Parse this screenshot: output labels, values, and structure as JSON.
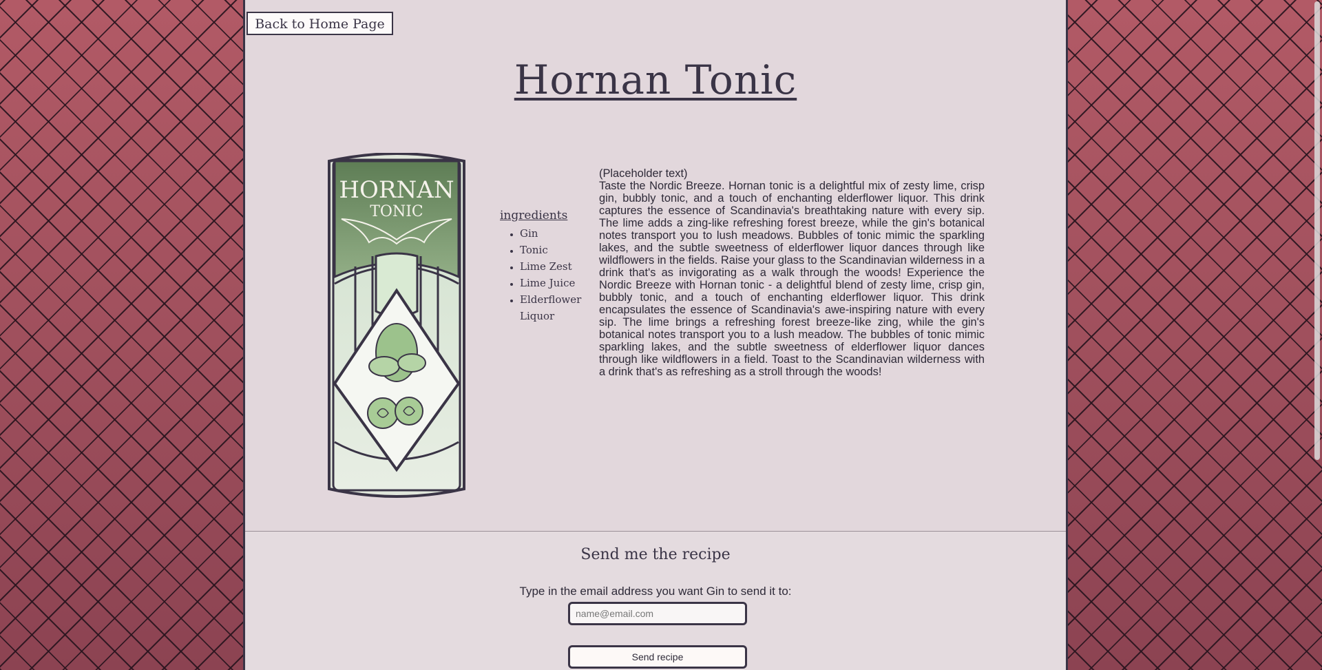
{
  "nav": {
    "back_label": "Back to Home Page"
  },
  "product": {
    "title": "Hornan Tonic",
    "label_brand": "HORNAN",
    "label_sub": "TONIC"
  },
  "ingredients": {
    "heading": "ingredients",
    "items": [
      "Gin",
      "Tonic",
      "Lime Zest",
      "Lime Juice",
      "Elderflower Liquor"
    ]
  },
  "description": {
    "placeholder_note": "(Placeholder text)",
    "body": "Taste the Nordic Breeze. Hornan tonic is a delightful mix of zesty lime, crisp gin, bubbly tonic, and a touch of enchanting elderflower liquor. This drink captures the essence of Scandinavia's breathtaking nature with every sip. The lime adds a zing-like refreshing forest breeze, while the gin's botanical notes transport you to lush meadows. Bubbles of tonic mimic the sparkling lakes, and the subtle sweetness of elderflower liquor dances through like wildflowers in the fields. Raise your glass to the Scandinavian wilderness in a drink that's as invigorating as a walk through the woods! Experience the Nordic Breeze with Hornan tonic - a delightful blend of zesty lime, crisp gin, bubbly tonic, and a touch of enchanting elderflower liquor. This drink encapsulates the essence of Scandinavia's awe-inspiring nature with every sip. The lime brings a refreshing forest breeze-like zing, while the gin's botanical notes transport you to a lush meadow. The bubbles of tonic mimic sparkling lakes, and the subtle sweetness of elderflower liquor dances through like wildflowers in a field. Toast to the Scandinavian wilderness with a drink that's as refreshing as a stroll through the woods!"
  },
  "recipe_form": {
    "heading": "Send me the recipe",
    "label": "Type in the email address you want Gin to send it to:",
    "email_value": "",
    "email_placeholder": "name@email.com",
    "submit_label": "Send recipe"
  },
  "colors": {
    "accent": "#3a3446",
    "panel": "#e2d7dc",
    "background": "#9c4e5a",
    "label_green": "#6f8f63"
  }
}
